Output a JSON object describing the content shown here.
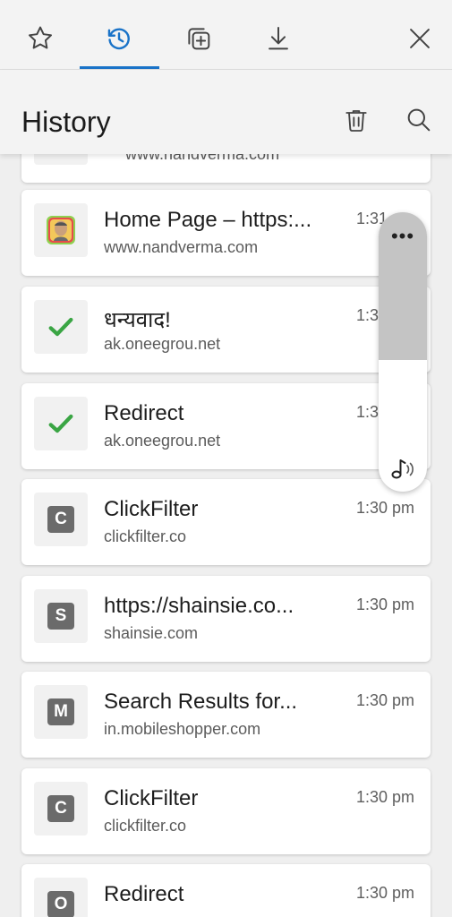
{
  "tabs": [
    {
      "name": "favorites",
      "icon": "star-icon"
    },
    {
      "name": "history",
      "icon": "history-icon",
      "active": true
    },
    {
      "name": "collections",
      "icon": "collections-icon"
    },
    {
      "name": "downloads",
      "icon": "download-icon"
    }
  ],
  "close_icon": "close-icon",
  "header": {
    "title": "History",
    "delete_icon": "trash-icon",
    "search_icon": "search-icon"
  },
  "partial_item": {
    "url": "www.nandverma.com"
  },
  "items": [
    {
      "title": "Home Page – https:...",
      "url": "www.nandverma.com",
      "time": "1:31 pm",
      "favicon": "photo"
    },
    {
      "title": "धन्यवाद!",
      "url": "ak.oneegrou.net",
      "time": "1:30 pm",
      "favicon": "check"
    },
    {
      "title": "Redirect",
      "url": "ak.oneegrou.net",
      "time": "1:30 pm",
      "favicon": "check"
    },
    {
      "title": "ClickFilter",
      "url": "clickfilter.co",
      "time": "1:30 pm",
      "favicon": "C"
    },
    {
      "title": "https://shainsie.co...",
      "url": "shainsie.com",
      "time": "1:30 pm",
      "favicon": "S"
    },
    {
      "title": "Search Results for...",
      "url": "in.mobileshopper.com",
      "time": "1:30 pm",
      "favicon": "M"
    },
    {
      "title": "ClickFilter",
      "url": "clickfilter.co",
      "time": "1:30 pm",
      "favicon": "C"
    },
    {
      "title": "Redirect",
      "url": "",
      "time": "1:30 pm",
      "favicon": "O"
    }
  ],
  "widget": {
    "dots": "•••",
    "icon": "music-note-icon"
  },
  "colors": {
    "accent": "#1a73c8",
    "check": "#3aa544"
  }
}
